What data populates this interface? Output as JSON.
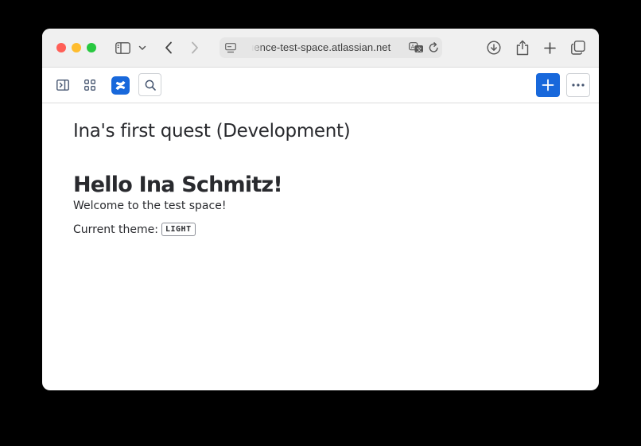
{
  "browser": {
    "address_text": "uence-test-space.atlassian.net",
    "icons": [
      "sidebar-icon",
      "chevron-down-icon",
      "back-icon",
      "forward-icon",
      "site-icon",
      "translate-icon",
      "reload-icon",
      "download-icon",
      "share-icon",
      "new-tab-icon",
      "tab-overview-icon"
    ]
  },
  "appbar": {
    "icons": [
      "expand-sidebar-icon",
      "app-switcher-icon",
      "confluence-logo-icon",
      "search-icon",
      "create-icon",
      "more-icon"
    ]
  },
  "page": {
    "title": "Ina's first quest (Development)",
    "heading": "Hello Ina Schmitz!",
    "welcome": "Welcome to the test space!",
    "theme_label": "Current theme:",
    "theme_value": "LIGHT"
  },
  "colors": {
    "brand_blue": "#1868db",
    "text": "#292a2e"
  }
}
